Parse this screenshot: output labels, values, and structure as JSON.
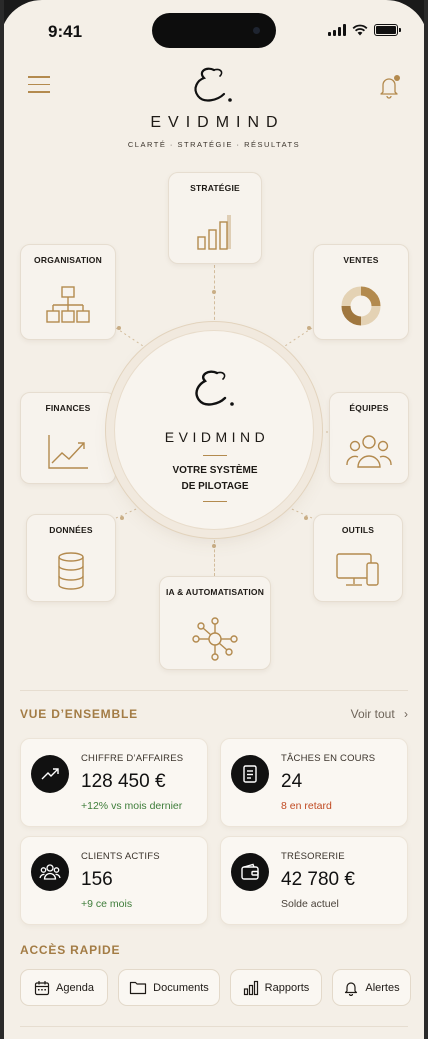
{
  "status_bar": {
    "time": "9:41"
  },
  "header": {
    "brand": "EVIDMIND",
    "tagline": "CLARTÉ · STRATÉGIE · RÉSULTATS"
  },
  "hub": {
    "center_brand": "EVIDMIND",
    "center_title_line1": "VOTRE SYSTÈME",
    "center_title_line2": "DE PILOTAGE",
    "modules": {
      "strategie": "STRATÉGIE",
      "organisation": "ORGANISATION",
      "ventes": "VENTES",
      "finances": "FINANCES",
      "equipes": "ÉQUIPES",
      "donnees": "DONNÉES",
      "outils": "OUTILS",
      "ia": "IA & AUTOMATISATION"
    }
  },
  "overview": {
    "title": "VUE D’ENSEMBLE",
    "see_all": "Voir tout",
    "cards": [
      {
        "label": "CHIFFRE D’AFFAIRES",
        "value": "128 450 €",
        "sub": "+12% vs mois dernier",
        "icon": "trend-up-icon"
      },
      {
        "label": "TÂCHES EN COURS",
        "value": "24",
        "sub": "8 en retard",
        "icon": "document-icon"
      },
      {
        "label": "CLIENTS ACTIFS",
        "value": "156",
        "sub": "+9 ce mois",
        "icon": "users-icon"
      },
      {
        "label": "TRÉSORERIE",
        "value": "42 780 €",
        "sub": "Solde actuel",
        "icon": "wallet-icon"
      }
    ]
  },
  "quick_access": {
    "title": "ACCÈS RAPIDE",
    "items": [
      "Agenda",
      "Documents",
      "Rapports",
      "Alertes"
    ]
  },
  "colors": {
    "accent": "#b38a4e",
    "background": "#f4efe7",
    "positive": "#3e7d3a",
    "negative": "#c04a22"
  }
}
